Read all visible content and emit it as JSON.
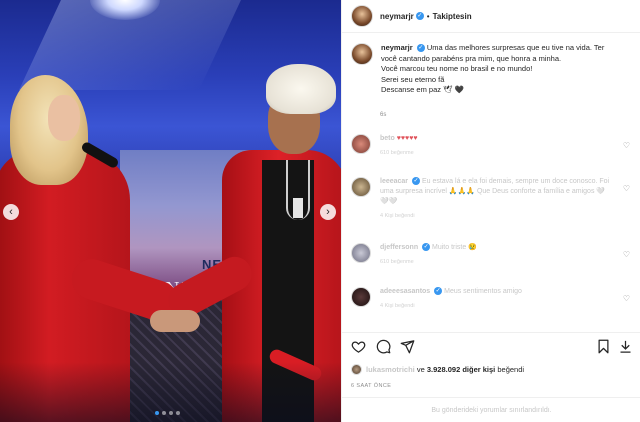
{
  "photo": {
    "screen_text_top": "NEY",
    "screen_text_bottom": "NUIT",
    "nav_left_icon": "chevron-left-icon",
    "nav_right_icon": "chevron-right-icon"
  },
  "header": {
    "username": "neymarjr",
    "separator": "•",
    "follow_label": "Takiptesin"
  },
  "caption": {
    "username": "neymarjr",
    "lines": [
      "Uma das melhores surpresas que eu tive na vida. Ter",
      "você cantando parabéns pra mim, que honra a minha.",
      "Você marcou teu nome no brasil e no mundo!",
      "Serei seu eterno fã",
      "Descanse em paz 🕊 🖤"
    ],
    "time": "6s"
  },
  "comments": [
    {
      "user": "beto",
      "text": "♥♥♥♥♥",
      "meta": "610 beğenme"
    },
    {
      "user": "leeeacar",
      "text": "Eu estava lá e ela foi demais, sempre um doce conosco. Foi uma surpresa incrível 🙏🙏🙏 Que Deus conforte a família e amigos 🤍🤍🤍",
      "meta": "4 Kişi beğendi"
    },
    {
      "user": "djeffersonn",
      "text": "Muito triste 😢",
      "meta": "610 beğenme"
    },
    {
      "user": "adeeesasantos",
      "text": "Meus sentimentos amigo",
      "meta": "4 Kişi beğendi"
    }
  ],
  "likes": {
    "liker": "lukasmotrichi",
    "connector": "ve",
    "count_text": "3.928.092 diğer kişi",
    "suffix": "beğendi"
  },
  "time_ago": "6 SAAT ÖNCE",
  "comments_disabled": "Bu gönderideki yorumlar sınırlandırıldı."
}
